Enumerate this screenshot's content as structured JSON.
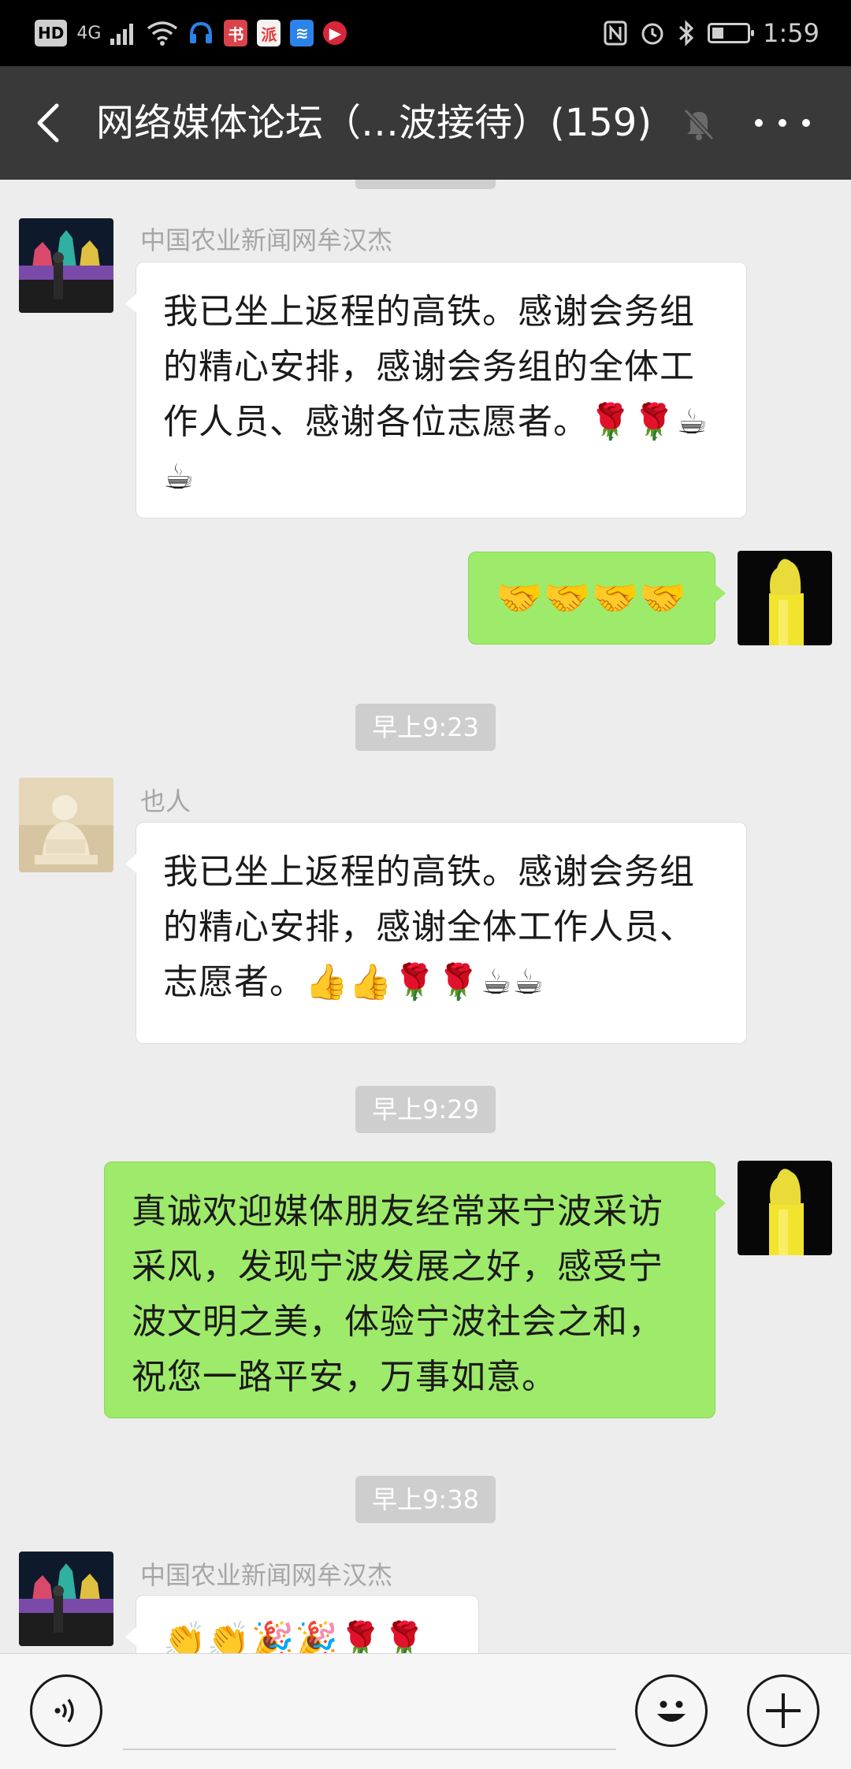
{
  "status_bar": {
    "hd_label": "HD",
    "network_label": "4G",
    "app_badges": [
      "书",
      "派",
      "≋",
      "▶"
    ],
    "time": "1:59"
  },
  "header": {
    "title": "网络媒体论坛（…波接待）(159)"
  },
  "messages": [
    {
      "sender": "中国农业新闻网牟汉杰",
      "text": "我已坐上返程的高铁。感谢会务组的精心安排，感谢会务组的全体工作人员、感谢各位志愿者。🌹🌹☕☕"
    },
    {
      "text": "🤝🤝🤝🤝"
    },
    {
      "timestamp": "早上9:23"
    },
    {
      "sender": "也人",
      "text": "我已坐上返程的高铁。感谢会务组的精心安排，感谢全体工作人员、志愿者。👍👍🌹🌹☕☕"
    },
    {
      "timestamp": "早上9:29"
    },
    {
      "text": "真诚欢迎媒体朋友经常来宁波采访采风，发现宁波发展之好，感受宁波文明之美，体验宁波社会之和，祝您一路平安，万事如意。"
    },
    {
      "timestamp": "早上9:38"
    },
    {
      "sender": "中国农业新闻网牟汉杰",
      "text": "👏👏🎉🎉🌹🌹"
    }
  ],
  "icons": {
    "back": "chevron-left-icon",
    "mute": "bell-muted-icon",
    "more": "more-dots-icon",
    "voice": "voice-icon",
    "emoji": "smiley-icon",
    "plus": "plus-icon"
  }
}
